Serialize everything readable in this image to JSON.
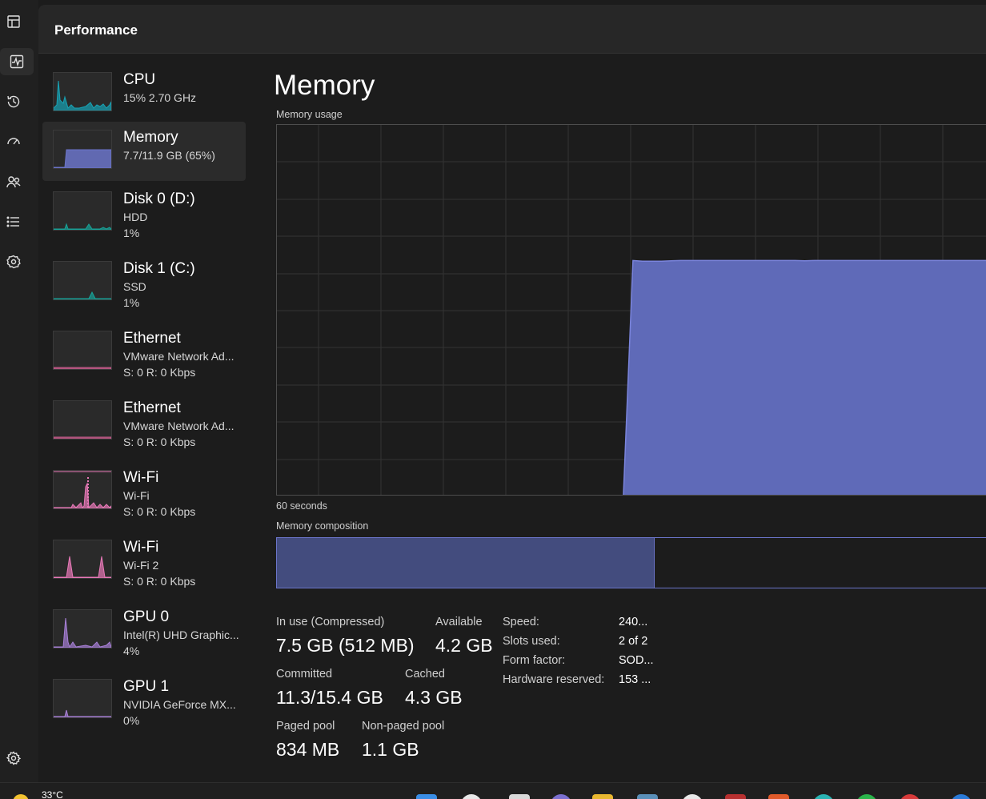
{
  "header": {
    "title": "Performance"
  },
  "rail": {
    "items": [
      {
        "name": "processes-icon"
      },
      {
        "name": "performance-icon",
        "active": true
      },
      {
        "name": "app-history-icon"
      },
      {
        "name": "startup-apps-icon"
      },
      {
        "name": "users-icon"
      },
      {
        "name": "details-icon"
      },
      {
        "name": "services-icon"
      }
    ],
    "settings": "settings-icon"
  },
  "perf_list": [
    {
      "name": "CPU",
      "sub1": "15%  2.70 GHz",
      "sub2": "",
      "color": "#17a3b5"
    },
    {
      "name": "Memory",
      "sub1": "7.7/11.9 GB (65%)",
      "sub2": "",
      "color": "#6b74c9"
    },
    {
      "name": "Disk 0 (D:)",
      "sub1": "HDD",
      "sub2": "1%",
      "color": "#17a398"
    },
    {
      "name": "Disk 1 (C:)",
      "sub1": "SSD",
      "sub2": "1%",
      "color": "#17a398"
    },
    {
      "name": "Ethernet",
      "sub1": "VMware Network Ad...",
      "sub2": "S: 0 R: 0 Kbps",
      "color": "#c75b8c"
    },
    {
      "name": "Ethernet",
      "sub1": "VMware Network Ad...",
      "sub2": "S: 0 R: 0 Kbps",
      "color": "#c75b8c"
    },
    {
      "name": "Wi-Fi",
      "sub1": "Wi-Fi",
      "sub2": "S: 0 R: 0 Kbps",
      "color": "#e879b8"
    },
    {
      "name": "Wi-Fi",
      "sub1": "Wi-Fi 2",
      "sub2": "S: 0 R: 0 Kbps",
      "color": "#e879b8"
    },
    {
      "name": "GPU 0",
      "sub1": "Intel(R) UHD Graphic...",
      "sub2": "4%",
      "color": "#a77fd6"
    },
    {
      "name": "GPU 1",
      "sub1": "NVIDIA GeForce MX...",
      "sub2": "0%",
      "color": "#a77fd6"
    }
  ],
  "main": {
    "title": "Memory",
    "usage_label": "Memory usage",
    "time_label": "60 seconds",
    "composition_label": "Memory composition",
    "composition_in_use_fraction": 0.53
  },
  "chart_data": {
    "type": "area",
    "series": [
      {
        "values": [
          0,
          0,
          0,
          0,
          0,
          0,
          0,
          0,
          0,
          0,
          0,
          0,
          0,
          0,
          0,
          0,
          0,
          0,
          0,
          0,
          0,
          0,
          0,
          0,
          0,
          0,
          0,
          0,
          0,
          0,
          0,
          0,
          0,
          0,
          0,
          0,
          0,
          0,
          0,
          0,
          63.5,
          63.3,
          63.3,
          63.3,
          63.4,
          63.5,
          63.5,
          63.5,
          63.5,
          63.5,
          63.5,
          63.5,
          63.5,
          63.5,
          63.5,
          63.5,
          63.5,
          63.5,
          63.4,
          63.5
        ]
      }
    ],
    "ylim": [
      0,
      100
    ],
    "x_span_seconds": 60,
    "grid": true
  },
  "stats": {
    "in_use_label": "In use (Compressed)",
    "in_use_value": "7.5 GB (512 MB)",
    "available_label": "Available",
    "available_value": "4.2 GB",
    "committed_label": "Committed",
    "committed_value": "11.3/15.4 GB",
    "cached_label": "Cached",
    "cached_value": "4.3 GB",
    "paged_label": "Paged pool",
    "paged_value": "834 MB",
    "nonpaged_label": "Non-paged pool",
    "nonpaged_value": "1.1 GB"
  },
  "details": [
    {
      "label": "Speed:",
      "value": "240..."
    },
    {
      "label": "Slots used:",
      "value": "2 of 2"
    },
    {
      "label": "Form factor:",
      "value": "SOD..."
    },
    {
      "label": "Hardware reserved:",
      "value": "153 ..."
    }
  ],
  "taskbar": {
    "weather_temp": "33°C"
  }
}
